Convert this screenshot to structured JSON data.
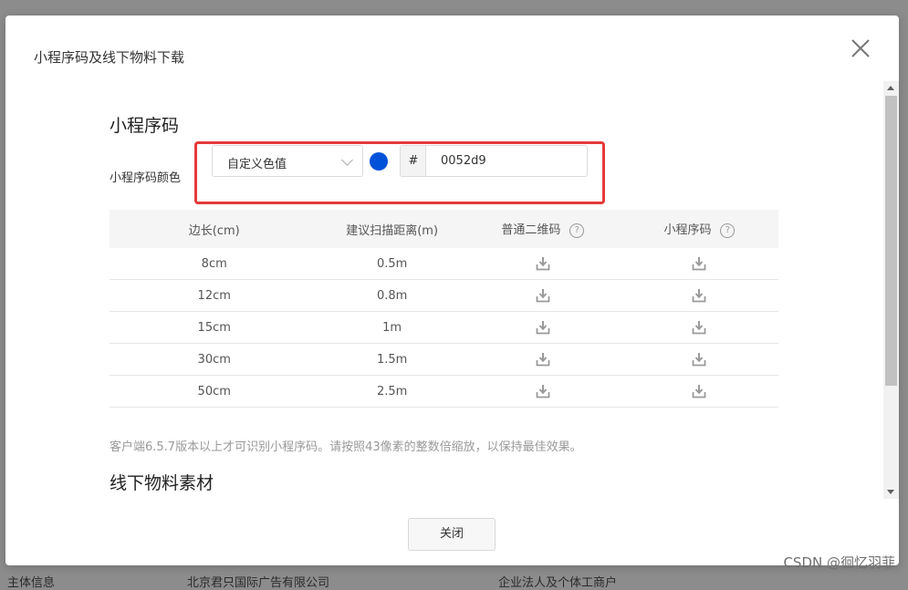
{
  "dialog": {
    "title": "小程序码及线下物料下载",
    "close_label": "关闭"
  },
  "mini_code": {
    "section_title": "小程序码",
    "color_label": "小程序码颜色",
    "color_mode_selected": "自定义色值",
    "swatch_color": "#0052d9",
    "hash_prefix": "#",
    "hex_value": "0052d9"
  },
  "table": {
    "headers": [
      "边长(cm)",
      "建议扫描距离(m)",
      "普通二维码",
      "小程序码"
    ],
    "help_glyph": "?",
    "rows": [
      [
        "8cm",
        "0.5m"
      ],
      [
        "12cm",
        "0.8m"
      ],
      [
        "15cm",
        "1m"
      ],
      [
        "30cm",
        "1.5m"
      ],
      [
        "50cm",
        "2.5m"
      ]
    ]
  },
  "note": "客户端6.5.7版本以上才可识别小程序码。请按照43像素的整数倍缩放，以保持最佳效果。",
  "offline_section_title": "线下物料素材",
  "background": {
    "row_text": [
      "主体信息",
      "北京君只国际广告有限公司",
      "企业法人及个体工商户"
    ]
  },
  "watermark": "CSDN @徊忆羽菲",
  "colors": {
    "highlight": "#e53a3a",
    "icon": "#9a9a9a"
  }
}
